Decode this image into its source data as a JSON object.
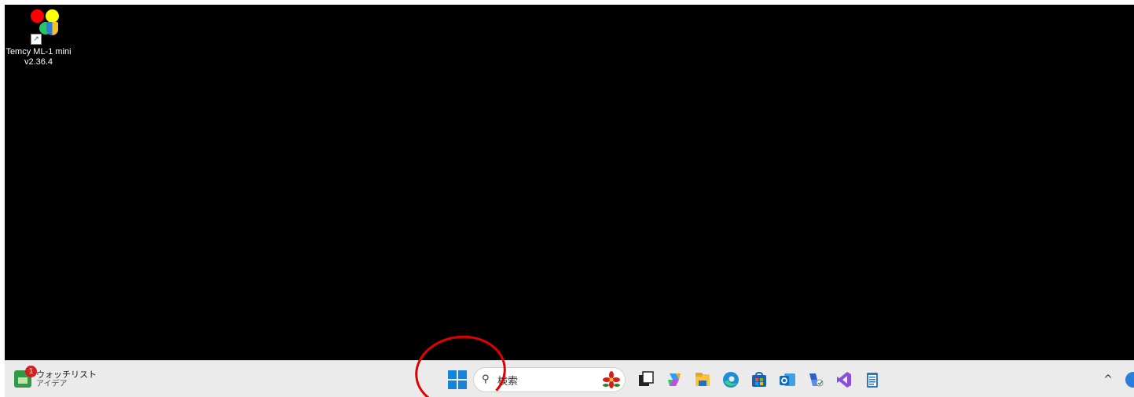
{
  "desktop": {
    "icon": {
      "name": "Temcy ML-1 mini",
      "version": "v2.36.4",
      "shortcut_arrow": "↗"
    }
  },
  "taskbar": {
    "widget": {
      "badge": "1",
      "title": "ウォッチリスト",
      "subtitle": "アイデア"
    },
    "search": {
      "placeholder": "検索",
      "icon": "search-icon"
    },
    "apps": [
      {
        "name": "task-view-icon",
        "color": "#222222"
      },
      {
        "name": "copilot-icon",
        "color": "#7a5cff"
      },
      {
        "name": "file-explorer-icon",
        "color": "#f6c343"
      },
      {
        "name": "edge-icon",
        "color": "#1b8fd6"
      },
      {
        "name": "store-icon",
        "color": "#1a5fb4"
      },
      {
        "name": "outlook-icon",
        "color": "#0f6cbd"
      },
      {
        "name": "remote-desktop-icon",
        "color": "#2a62c9"
      },
      {
        "name": "visual-studio-icon",
        "color": "#8a4fd6"
      },
      {
        "name": "notepad-icon",
        "color": "#2b76c5"
      }
    ],
    "tray": {
      "chevron": "^"
    }
  },
  "annotation_color": "#e00000"
}
